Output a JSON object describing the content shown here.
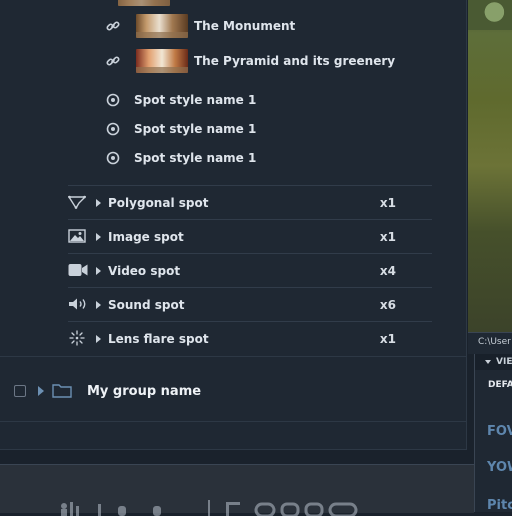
{
  "linked_panoramas": [
    {
      "label": "The Monument",
      "icon": "link-icon"
    },
    {
      "label": "The Pyramid and its greenery",
      "icon": "link-icon"
    }
  ],
  "style_spots": [
    {
      "label": "Spot style name 1",
      "icon": "target-icon"
    },
    {
      "label": "Spot style name 1",
      "icon": "target-icon"
    },
    {
      "label": "Spot style name 1",
      "icon": "target-icon"
    }
  ],
  "spot_categories": [
    {
      "label": "Polygonal spot",
      "count": "x1",
      "icon": "polygon-icon"
    },
    {
      "label": "Image spot",
      "count": "x1",
      "icon": "image-icon"
    },
    {
      "label": "Video spot",
      "count": "x4",
      "icon": "video-icon"
    },
    {
      "label": "Sound spot",
      "count": "x6",
      "icon": "speaker-icon"
    },
    {
      "label": "Lens flare spot",
      "count": "x1",
      "icon": "lens-flare-icon"
    }
  ],
  "group": {
    "name": "My group name"
  },
  "path_bar": {
    "text": "C:\\User"
  },
  "view_panel": {
    "header": "VIE",
    "tab": "DEFA",
    "labels": [
      "FOV",
      "YOW",
      "Pitch"
    ]
  },
  "colors": {
    "panel": "#1f2833",
    "accent": "#5e86ad"
  }
}
